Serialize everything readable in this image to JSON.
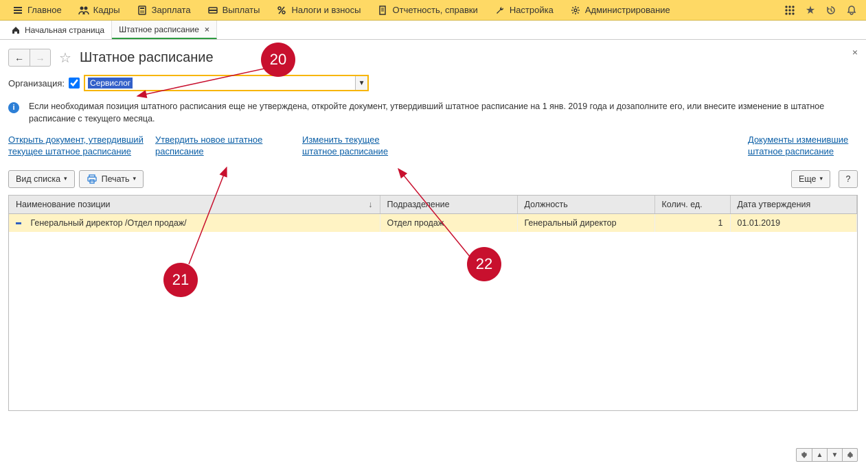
{
  "topmenu": {
    "main": "Главное",
    "hr": "Кадры",
    "salary": "Зарплата",
    "payments": "Выплаты",
    "taxes": "Налоги и взносы",
    "reports": "Отчетность, справки",
    "settings": "Настройка",
    "admin": "Администрирование"
  },
  "tabs": {
    "home": "Начальная страница",
    "staff": "Штатное расписание"
  },
  "header": {
    "title": "Штатное расписание"
  },
  "org": {
    "label": "Организация:",
    "value": "Сервислог"
  },
  "info": {
    "text": "Если необходимая позиция штатного расписания еще не утверждена, откройте документ, утвердивший штатное расписание на 1 янв. 2019 года и дозаполните его, или внесите изменение в штатное расписание с текущего месяца."
  },
  "links": {
    "open_doc": "Открыть документ, утвердивший текущее штатное расписание",
    "approve": "Утвердить новое штатное расписание",
    "change": "Изменить текущее штатное расписание",
    "docs_changed": "Документы изменившие штатное расписание"
  },
  "toolbar": {
    "view": "Вид списка",
    "print": "Печать",
    "more": "Еще",
    "help": "?"
  },
  "table": {
    "cols": {
      "name": "Наименование позиции",
      "dept": "Подразделение",
      "role": "Должность",
      "qty": "Колич. ед.",
      "date": "Дата утверждения"
    },
    "rows": [
      {
        "name": "Генеральный директор /Отдел продаж/",
        "dept": "Отдел продаж",
        "role": "Генеральный директор",
        "qty": "1",
        "date": "01.01.2019"
      }
    ]
  },
  "callouts": {
    "c20": "20",
    "c21": "21",
    "c22": "22"
  }
}
